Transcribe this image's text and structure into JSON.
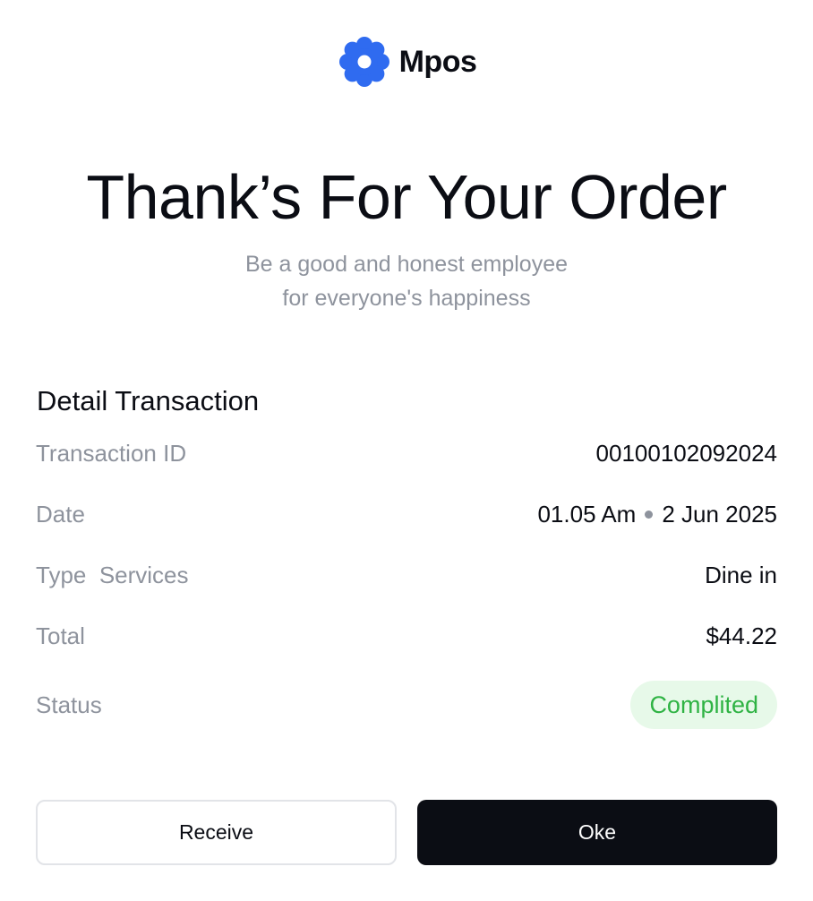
{
  "brand": {
    "name": "Mpos",
    "icon": "flower-logo-icon",
    "color": "#2f6bf0"
  },
  "hero": {
    "title": "Thank’s For Your Order",
    "subtitle_line1": "Be a good and honest employee",
    "subtitle_line2": "for everyone's happiness"
  },
  "details": {
    "title": "Detail Transaction",
    "transaction_id": {
      "label": "Transaction ID",
      "value": "00100102092024"
    },
    "date": {
      "label": "Date",
      "time": "01.05 Am",
      "day": "2 Jun 2025"
    },
    "type": {
      "label": "Type  Services",
      "value": "Dine in"
    },
    "total": {
      "label": "Total",
      "value": "$44.22"
    },
    "status": {
      "label": "Status",
      "value": "Complited",
      "color": "#2fb344",
      "background": "#e7f9e9"
    }
  },
  "actions": {
    "receive_label": "Receive",
    "oke_label": "Oke"
  }
}
